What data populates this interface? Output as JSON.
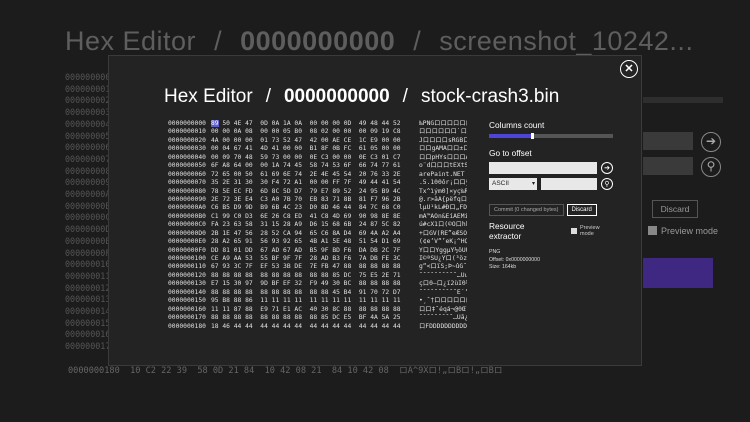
{
  "background": {
    "title_app": "Hex Editor",
    "title_sep": "/",
    "title_offset": "0000000000",
    "title_file": "screenshot_10242...",
    "row_offsets": [
      "0000000000",
      "0000000010",
      "0000000020",
      "0000000030",
      "0000000040",
      "0000000050",
      "0000000060",
      "0000000070",
      "0000000080",
      "0000000090",
      "00000000A0",
      "00000000B0",
      "00000000C0",
      "00000000D0",
      "00000000E0",
      "00000000F0",
      "0000000100",
      "0000000110",
      "0000000120",
      "0000000130",
      "0000000140",
      "0000000150",
      "0000000160",
      "0000000170"
    ],
    "bottom_row": "0000000180  10 C2 22 39  58 0D 21 84  10 42 08 21  84 10 42 08  ロA^9Xロ!„ロBロ!„ロBロ",
    "discard_label": "Discard",
    "preview_label": "Preview mode",
    "go_icon": "arrow-right-icon",
    "search_icon": "search-icon"
  },
  "dialog": {
    "close_icon": "close-icon",
    "title_app": "Hex Editor",
    "title_sep": "/",
    "title_offset": "0000000000",
    "title_file": "stock-crash3.bin",
    "hex_rows": [
      {
        "addr": "0000000000",
        "hex": "89 50 4E 47  0D 0A 1A 0A  00 00 00 0D  49 48 44 52",
        "text": "‰PNGロロロロロロロロIHDR"
      },
      {
        "addr": "0000000010",
        "hex": "00 00 0A 08  00 00 05 B0  08 02 00 00  00 09 19 C8",
        "text": "ロロロロロロ`ロロロロロロロロÈ"
      },
      {
        "addr": "0000000020",
        "hex": "4A 00 00 00  01 73 52 47  42 00 AE CE  1C E9 00 00",
        "text": "JロロロロsRGBロ®Îロéロロ"
      },
      {
        "addr": "0000000030",
        "hex": "00 04 67 41  4D 41 00 00  B1 8F 0B FC  61 05 00 00",
        "text": "ロロgAMAロロ±ロロüaロロロ"
      },
      {
        "addr": "0000000040",
        "hex": "00 09 70 48  59 73 00 00  0E C3 00 00  0E C3 01 C7",
        "text": "ロロpHYsロロロÃロロロÃロÇ"
      },
      {
        "addr": "0000000050",
        "hex": "6F A8 64 00  00 1A 74 45  58 74 53 6F  66 74 77 61",
        "text": "o¨dロロロtEXtSoftwa"
      },
      {
        "addr": "0000000060",
        "hex": "72 65 00 50  61 69 6E 74  2E 4E 45 54  20 76 33 2E",
        "text": "arePaint.NET v3"
      },
      {
        "addr": "0000000070",
        "hex": "35 2E 31 30  30 F4 72 A1  00 00 FF 7F  49 44 41 54",
        "text": ".5.100ôr¡ロロÿロIDA"
      },
      {
        "addr": "0000000080",
        "hex": "78 5E EC FD  6D 8C 5D D7  79 E7 89 52  24 95 B9 4C",
        "text": "Tx^ìým0]×yç‰R$•¹"
      },
      {
        "addr": "0000000090",
        "hex": "2E 72 3E E4  C3 A0 7B 70  EB 83 71 8B  81 F7 96 2B",
        "text": "@.r>äÃ{pëfqロロ÷–"
      },
      {
        "addr": "00000000A0",
        "hex": "C6 B5 D9 9D  B9 6B 4C 23  D0 8D 46 44  84 7C 68 C0",
        "text": "lµÙ¹kL#Ðロ„FD„|hÀ"
      },
      {
        "addr": "00000000B0",
        "hex": "C1 99 C0 D3  6E 26 C8 ED  41 C8 4D 69  90 98 8E 8E",
        "text": "mA™ÀÓn&ÈíAÈMiロ˜Ž"
      },
      {
        "addr": "00000000C0",
        "hex": "FA 23 63 58  31 15 28 A9  D6 15 68 6B  24 87 5C 82",
        "text": "ú#cX1ロ(©Öロhk$‡\\"
      },
      {
        "addr": "00000000D0",
        "hex": "2B 1E 47 56  28 52 CA 94  65 C6 8A D4  69 4A A2 A4",
        "text": "+ロGV(RÊ”eÆŠÔiJ¢¤"
      },
      {
        "addr": "00000000E0",
        "hex": "28 A2 65 91  56 93 92 65  4B A1 5E 48  51 54 D1 69",
        "text": "(¢e‘V“’eK¡^HQTÑi"
      },
      {
        "addr": "00000000F0",
        "hex": "DD 81 01 DD  67 AD 67 AD  B5 9F BD F6  DA DB 2C 7F",
        "text": "ÝロロÝg­g­µŸ½öÚÛ,ロ"
      },
      {
        "addr": "0000000100",
        "hex": "CE A9 AA 53  55 BF 9F 7F  28 AD B3 F6  7A DB FE 3C",
        "text": "Î©ªSU¿Ÿロ(­³özÛþ<"
      },
      {
        "addr": "0000000110",
        "hex": "67 93 3C 7F  EF 53 3B DE  7E FB 47 88  88 88 88 88",
        "text": "g“<ロïS;Þ~ûGˆˆˆˆˆ"
      },
      {
        "addr": "0000000120",
        "hex": "88 88 88 88  88 88 88 88  88 88 85 DC  75 E5 2E 71",
        "text": "ˆˆˆˆˆˆˆˆˆˆ…Üuå.q"
      },
      {
        "addr": "0000000130",
        "hex": "E7 15 30 97  9D BF EF 32  F9 49 30 BC  88 88 88 88",
        "text": "çロ0—ロ¿ï2ùI0¼ˆˆˆˆ"
      },
      {
        "addr": "0000000140",
        "hex": "88 88 88 88  88 88 88 88  88 88 45 B4  91 70 72 D7",
        "text": "ˆˆˆˆˆˆˆˆˆˆE´‘pr×"
      },
      {
        "addr": "0000000150",
        "hex": "95 B8 88 86  11 11 11 11  11 11 11 11  11 11 11 11",
        "text": "•¸ˆ†ロロロロロロロロロロロロ"
      },
      {
        "addr": "0000000160",
        "hex": "11 11 87 88  E9 71 E1 AC  40 30 8C 88  88 88 88 88",
        "text": "ロロ‡ˆéqá¬@0Œˆˆˆˆˆ"
      },
      {
        "addr": "0000000170",
        "hex": "88 88 88 88  88 88 88 88  88 85 DC E5  BF 4A 5A 25",
        "text": "ˆˆˆˆˆˆˆˆˆ…Üå¿JZ%"
      },
      {
        "addr": "0000000180",
        "hex": "18 46 44 44  44 44 44 44  44 44 44 44  44 44 44 44",
        "text": "ロFDDDDDDDDDDDDDD"
      }
    ],
    "columns_label": "Columns count",
    "columns_value": 0.35,
    "goto_label": "Go to offset",
    "go_icon": "arrow-right-icon",
    "search_icon": "search-icon",
    "encoding": "ASCII",
    "commit_label": "Commit (0 changed bytes)",
    "discard_label": "Discard",
    "resource_label": "Resource extractor",
    "preview_label": "Preview mode",
    "info_type": "PNG",
    "info_offset": "Offset: 0x0000000000",
    "info_size": "Size: 164kb"
  }
}
